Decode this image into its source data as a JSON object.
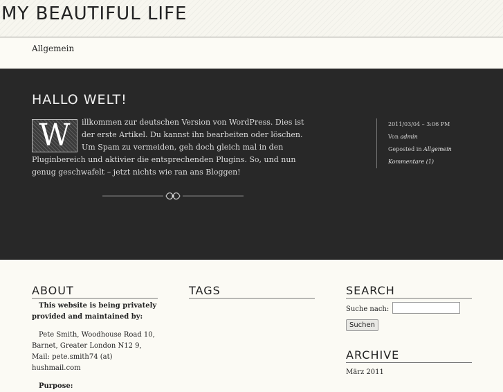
{
  "site": {
    "title": "MY BEAUTIFUL LIFE"
  },
  "nav": {
    "items": [
      {
        "label": "Allgemein"
      }
    ]
  },
  "post": {
    "title": "HALLO WELT!",
    "dropcap": "W",
    "body": "illkommen zur deutschen Version von WordPress. Dies ist der erste Artikel. Du kannst ihn bearbeiten oder löschen. Um Spam zu vermeiden, geh doch gleich mal in den Pluginbereich und aktivier die entsprechenden Plugins. So, und nun genug geschwafelt – jetzt nichts wie ran ans Bloggen!",
    "meta": {
      "datetime": "2011/03/04 – 3:06 PM",
      "by_prefix": "Von",
      "author": "admin",
      "category_prefix": "Geposted in",
      "category": "Allgemein",
      "comments": "Kommentare (1)"
    }
  },
  "widgets": {
    "about": {
      "title": "ABOUT",
      "line1": "This website is being privately provided and maintained by:",
      "line2": "Pete Smith, Woodhouse Road 10, Barnet, Greater London N12 9, Mail: pete.smith74 (at) hushmail.com",
      "line3": "Purpose:"
    },
    "tags": {
      "title": "TAGS"
    },
    "search": {
      "title": "SEARCH",
      "label": "Suche nach:",
      "value": "",
      "button": "Suchen"
    },
    "archive": {
      "title": "ARCHIVE",
      "items": [
        {
          "label": "März 2011"
        }
      ]
    }
  }
}
